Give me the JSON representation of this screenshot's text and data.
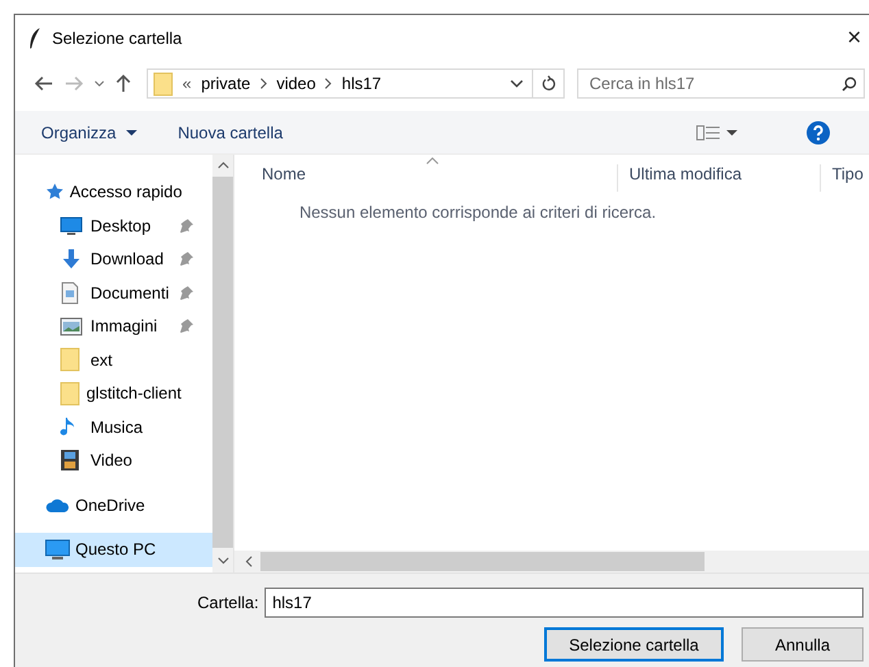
{
  "window": {
    "title": "Selezione cartella",
    "close": "×"
  },
  "address": {
    "overflow": "«",
    "segments": [
      "private",
      "video",
      "hls17"
    ]
  },
  "search": {
    "placeholder": "Cerca in hls17"
  },
  "toolbar": {
    "organize": "Organizza",
    "new_folder": "Nuova cartella"
  },
  "sidebar": {
    "items": [
      {
        "label": "Accesso rapido",
        "kind": "quick",
        "selected": false,
        "children": [
          {
            "label": "Desktop",
            "kind": "desktop",
            "pinned": true,
            "selected": false
          },
          {
            "label": "Download",
            "kind": "download",
            "pinned": true,
            "selected": false
          },
          {
            "label": "Documenti",
            "kind": "documents",
            "pinned": true,
            "selected": false
          },
          {
            "label": "Immagini",
            "kind": "pictures",
            "pinned": true,
            "selected": false
          },
          {
            "label": "ext",
            "kind": "folder",
            "pinned": false,
            "selected": false
          },
          {
            "label": "glstitch-client",
            "kind": "folder",
            "pinned": false,
            "selected": false
          },
          {
            "label": "Musica",
            "kind": "music",
            "pinned": false,
            "selected": false
          },
          {
            "label": "Video",
            "kind": "video",
            "pinned": false,
            "selected": false
          }
        ]
      },
      {
        "label": "OneDrive",
        "kind": "cloud",
        "selected": false
      },
      {
        "label": "Questo PC",
        "kind": "pc",
        "selected": true
      }
    ]
  },
  "table": {
    "columns": [
      "Nome",
      "Ultima modifica",
      "Tipo"
    ],
    "empty_message": "Nessun elemento corrisponde ai criteri di ricerca."
  },
  "folder_field": {
    "label": "Cartella:",
    "value": "hls17"
  },
  "buttons": [
    {
      "label": "Selezione cartella",
      "default": true
    },
    {
      "label": "Annulla",
      "default": false
    }
  ]
}
